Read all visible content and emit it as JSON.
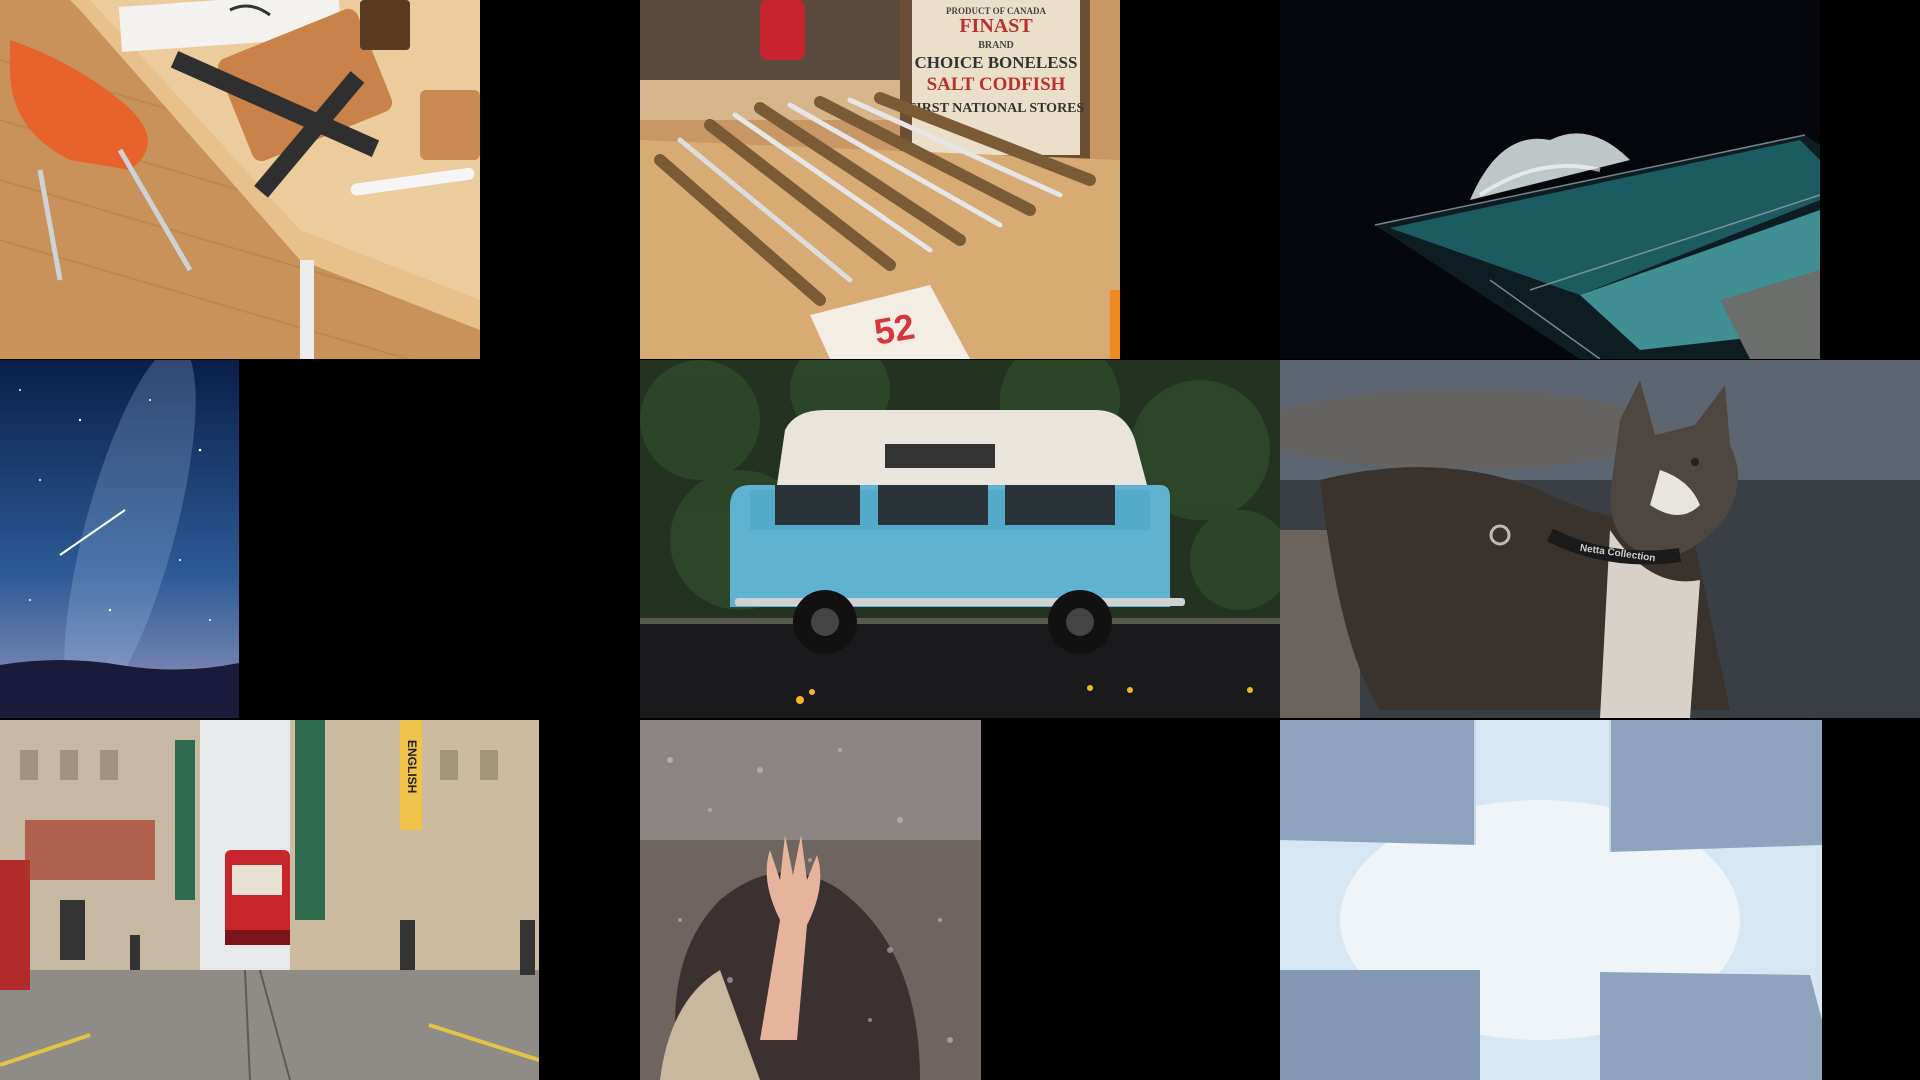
{
  "gallery": {
    "tiles": [
      {
        "subject": "wooden desk with orange chair, notebook, ruler and pen"
      },
      {
        "subject": "wooden box and row of brushes and pencils",
        "box_text": [
          "PRODUCT OF CANADA",
          "FINAST",
          "BRAND",
          "CHOICE BONELESS",
          "SALT CODFISH",
          "FIRST NATIONAL STORES"
        ],
        "tag_text": "52"
      },
      {
        "subject": "ocean pool at night with crashing wave"
      },
      {
        "subject": "milky way night sky over hills with shooting star"
      },
      {
        "subject": "blue vintage camper van parked on street"
      },
      {
        "subject": "husky dog wearing harness",
        "harness_text": "Netta Collection"
      },
      {
        "subject": "city street with red tram and pedestrians",
        "sign_text": "ENGLISH"
      },
      {
        "subject": "hand pressed against rainy window"
      },
      {
        "subject": "looking up between concrete blocks at sky"
      }
    ]
  }
}
